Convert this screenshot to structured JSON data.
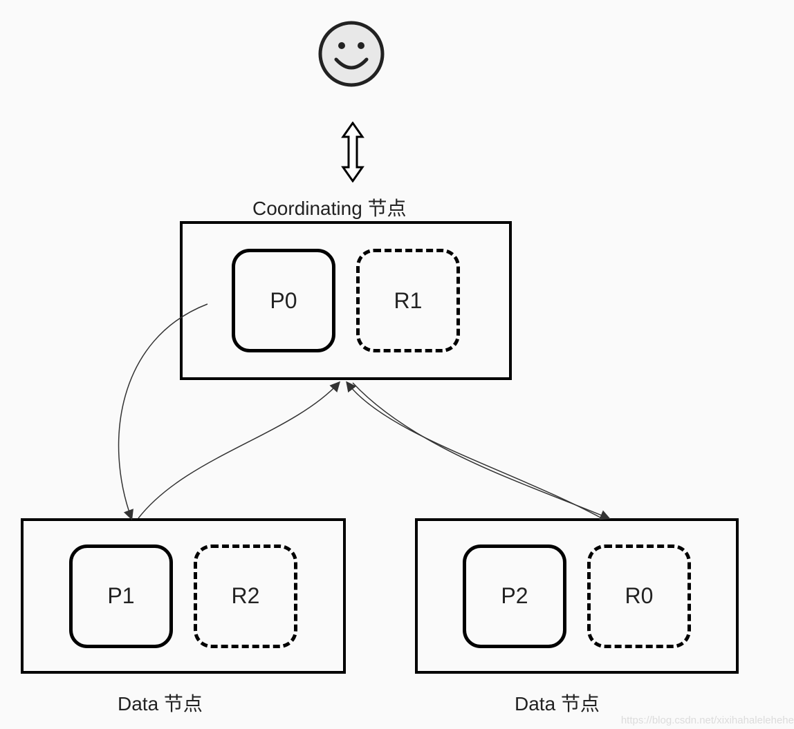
{
  "labels": {
    "coordinating": "Coordinating 节点",
    "dataLeft": "Data 节点",
    "dataRight": "Data 节点"
  },
  "coordNode": {
    "primary": "P0",
    "replica": "R1"
  },
  "dataNodeLeft": {
    "primary": "P1",
    "replica": "R2"
  },
  "dataNodeRight": {
    "primary": "P2",
    "replica": "R0"
  },
  "watermark": "https://blog.csdn.net/xixihahalelehehe"
}
